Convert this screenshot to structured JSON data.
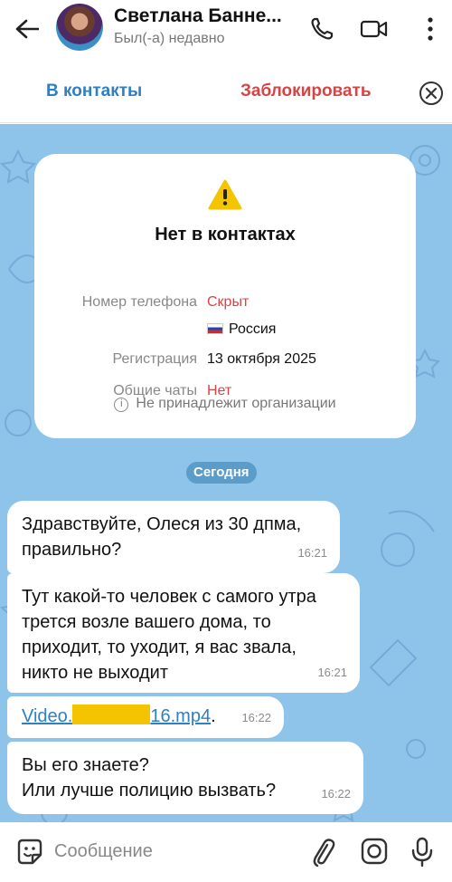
{
  "header": {
    "title": "Светлана Банне...",
    "status": "Был(-а) недавно",
    "icons": [
      "back-arrow-icon",
      "phone-icon",
      "video-call-icon",
      "more-icon"
    ]
  },
  "actions": {
    "add_contact": "В контакты",
    "block": "Заблокировать"
  },
  "info_card": {
    "title": "Нет в контактах",
    "rows": [
      {
        "label": "Номер телефона",
        "value": "Скрыт"
      },
      {
        "label": "",
        "value": "Россия"
      },
      {
        "label": "Регистрация",
        "value": "13 октября 2025"
      },
      {
        "label": "Общие чаты",
        "value": "Нет"
      }
    ],
    "org_note": "Не принадлежит организации"
  },
  "date_chip": "Сегодня",
  "messages": [
    {
      "line1": "Здравствуйте, Олеся из 30 дпма,",
      "line2": "правильно?",
      "time": "16:21"
    },
    {
      "line1": "Тут какой-то человек с самого утра",
      "line2": "трется возле вашего дома, то",
      "line3": "приходит, то уходит, я вас звала,",
      "line4": "никто не выходит",
      "time": "16:21"
    },
    {
      "link_start": "Video.",
      "link_end": "16.mp4",
      "time": "16:22"
    },
    {
      "line1": "Вы его знаете?",
      "line2": "Или лучше полицию вызвать?",
      "time": "16:22"
    }
  ],
  "composer": {
    "placeholder": "Сообщение"
  },
  "colors": {
    "accent": "#2f7fc1",
    "danger": "#d64545",
    "chat_bg": "#8ec3ea",
    "highlight": "#f5c400"
  }
}
